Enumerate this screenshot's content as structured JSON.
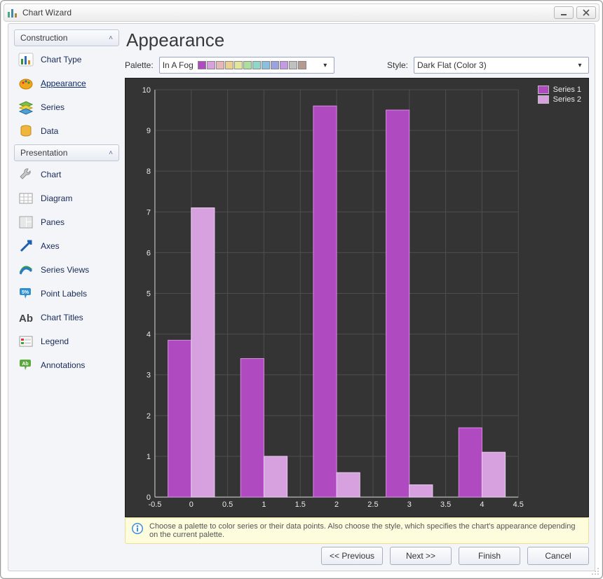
{
  "window": {
    "title": "Chart Wizard"
  },
  "sidebar": {
    "sections": [
      {
        "title": "Construction",
        "items": [
          {
            "key": "chart-type",
            "label": "Chart Type"
          },
          {
            "key": "appearance",
            "label": "Appearance",
            "selected": true
          },
          {
            "key": "series",
            "label": "Series"
          },
          {
            "key": "data",
            "label": "Data"
          }
        ]
      },
      {
        "title": "Presentation",
        "items": [
          {
            "key": "chart",
            "label": "Chart"
          },
          {
            "key": "diagram",
            "label": "Diagram"
          },
          {
            "key": "panes",
            "label": "Panes"
          },
          {
            "key": "axes",
            "label": "Axes"
          },
          {
            "key": "series-views",
            "label": "Series Views"
          },
          {
            "key": "point-labels",
            "label": "Point Labels"
          },
          {
            "key": "chart-titles",
            "label": "Chart Titles"
          },
          {
            "key": "legend",
            "label": "Legend"
          },
          {
            "key": "annotations",
            "label": "Annotations"
          }
        ]
      }
    ]
  },
  "page": {
    "title": "Appearance"
  },
  "controls": {
    "palette": {
      "label": "Palette:",
      "value": "In A Fog",
      "swatches": [
        "#b04ac0",
        "#d7a1e0",
        "#e7b6b6",
        "#eacf93",
        "#e2e69a",
        "#aede9f",
        "#8fd7c7",
        "#8abfe0",
        "#9aa2e0",
        "#c59ae0",
        "#c0c0c0",
        "#b79a8f"
      ]
    },
    "style": {
      "label": "Style:",
      "value": "Dark Flat (Color 3)"
    }
  },
  "legend": {
    "s1": "Series 1",
    "s2": "Series 2",
    "c1": "#b04ac0",
    "c2": "#d7a1e0"
  },
  "hint": "Choose a palette to color series or their data points. Also choose the style, which specifies the chart's appearance depending on the current palette.",
  "footer": {
    "prev": "<< Previous",
    "next": "Next >>",
    "finish": "Finish",
    "cancel": "Cancel"
  },
  "chart_data": {
    "type": "bar",
    "xlabel": "",
    "ylabel": "",
    "xlim": [
      -0.5,
      4.5
    ],
    "ylim": [
      0,
      10
    ],
    "xticks": [
      -0.5,
      0,
      0.5,
      1,
      1.5,
      2,
      2.5,
      3,
      3.5,
      4,
      4.5
    ],
    "yticks": [
      0,
      1,
      2,
      3,
      4,
      5,
      6,
      7,
      8,
      9,
      10
    ],
    "categories": [
      0,
      1,
      2,
      3,
      4
    ],
    "series": [
      {
        "name": "Series 1",
        "values": [
          3.85,
          3.4,
          9.6,
          9.5,
          1.7
        ]
      },
      {
        "name": "Series 2",
        "values": [
          7.1,
          1.0,
          0.6,
          0.3,
          1.1
        ]
      }
    ]
  }
}
